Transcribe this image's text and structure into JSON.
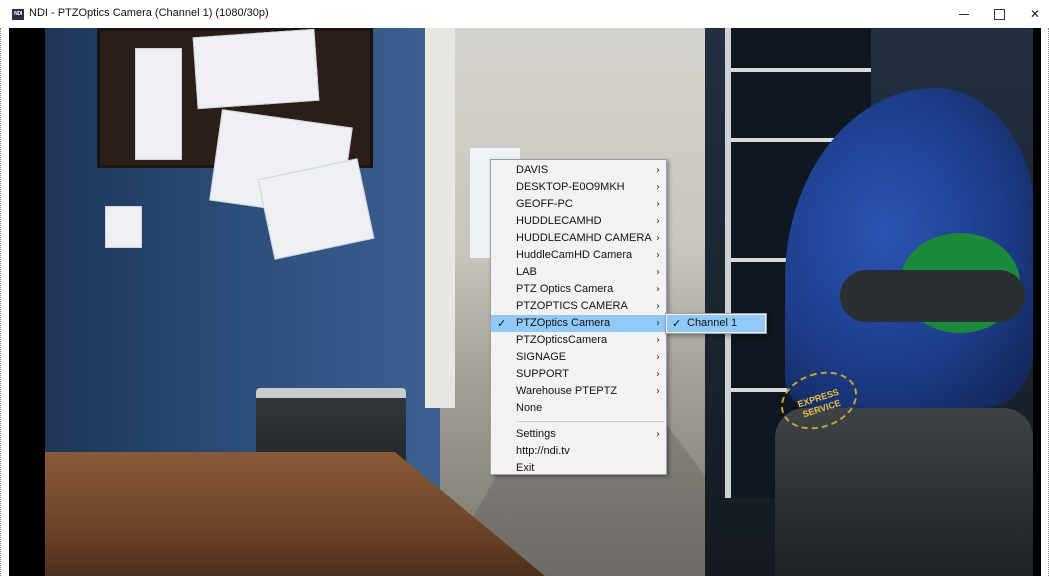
{
  "window": {
    "app_icon": "NDI",
    "title": "NDI - PTZOptics Camera (Channel 1) (1080/30p)",
    "controls": [
      "minimize-icon",
      "maximize-icon",
      "close-icon"
    ]
  },
  "scene": {
    "badge_text": "EXPRESS SERVICE"
  },
  "menu": {
    "items": [
      {
        "label": "DAVIS",
        "submenu": true
      },
      {
        "label": "DESKTOP-E0O9MKH",
        "submenu": true
      },
      {
        "label": "GEOFF-PC",
        "submenu": true
      },
      {
        "label": "HUDDLECAMHD",
        "submenu": true
      },
      {
        "label": "HUDDLECAMHD CAMERA",
        "submenu": true
      },
      {
        "label": "HuddleCamHD Camera",
        "submenu": true
      },
      {
        "label": "LAB",
        "submenu": true
      },
      {
        "label": "PTZ Optics Camera",
        "submenu": true
      },
      {
        "label": "PTZOPTICS CAMERA",
        "submenu": true
      },
      {
        "label": "PTZOptics Camera",
        "submenu": true,
        "checked": true,
        "selected": true
      },
      {
        "label": "PTZOpticsCamera",
        "submenu": true
      },
      {
        "label": "SIGNAGE",
        "submenu": true
      },
      {
        "label": "SUPPORT",
        "submenu": true
      },
      {
        "label": "Warehouse PTEPTZ",
        "submenu": true
      },
      {
        "label": "None",
        "submenu": false
      }
    ],
    "footer_items": [
      {
        "label": "Settings",
        "submenu": true
      },
      {
        "label": "http://ndi.tv",
        "submenu": false
      },
      {
        "label": "Exit",
        "submenu": false
      }
    ]
  },
  "submenu": {
    "items": [
      {
        "label": "Channel 1",
        "checked": true
      }
    ]
  },
  "colors": {
    "menu_bg": "#f2f2f2",
    "selection": "#91c9f7"
  }
}
